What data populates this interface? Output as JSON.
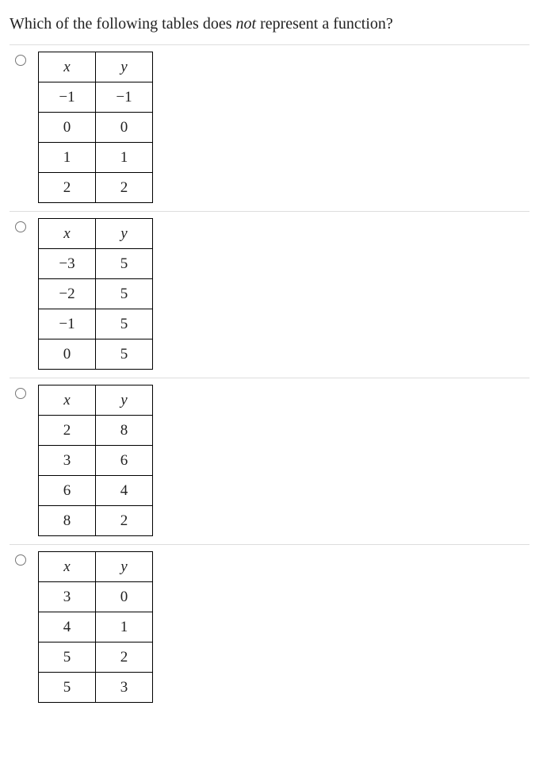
{
  "question_prefix": "Which of the following tables does ",
  "question_not": "not",
  "question_suffix": " represent a function?",
  "header_x": "x",
  "header_y": "y",
  "options": [
    {
      "rows": [
        [
          "−1",
          "−1"
        ],
        [
          "0",
          "0"
        ],
        [
          "1",
          "1"
        ],
        [
          "2",
          "2"
        ]
      ]
    },
    {
      "rows": [
        [
          "−3",
          "5"
        ],
        [
          "−2",
          "5"
        ],
        [
          "−1",
          "5"
        ],
        [
          "0",
          "5"
        ]
      ]
    },
    {
      "rows": [
        [
          "2",
          "8"
        ],
        [
          "3",
          "6"
        ],
        [
          "6",
          "4"
        ],
        [
          "8",
          "2"
        ]
      ]
    },
    {
      "rows": [
        [
          "3",
          "0"
        ],
        [
          "4",
          "1"
        ],
        [
          "5",
          "2"
        ],
        [
          "5",
          "3"
        ]
      ]
    }
  ]
}
